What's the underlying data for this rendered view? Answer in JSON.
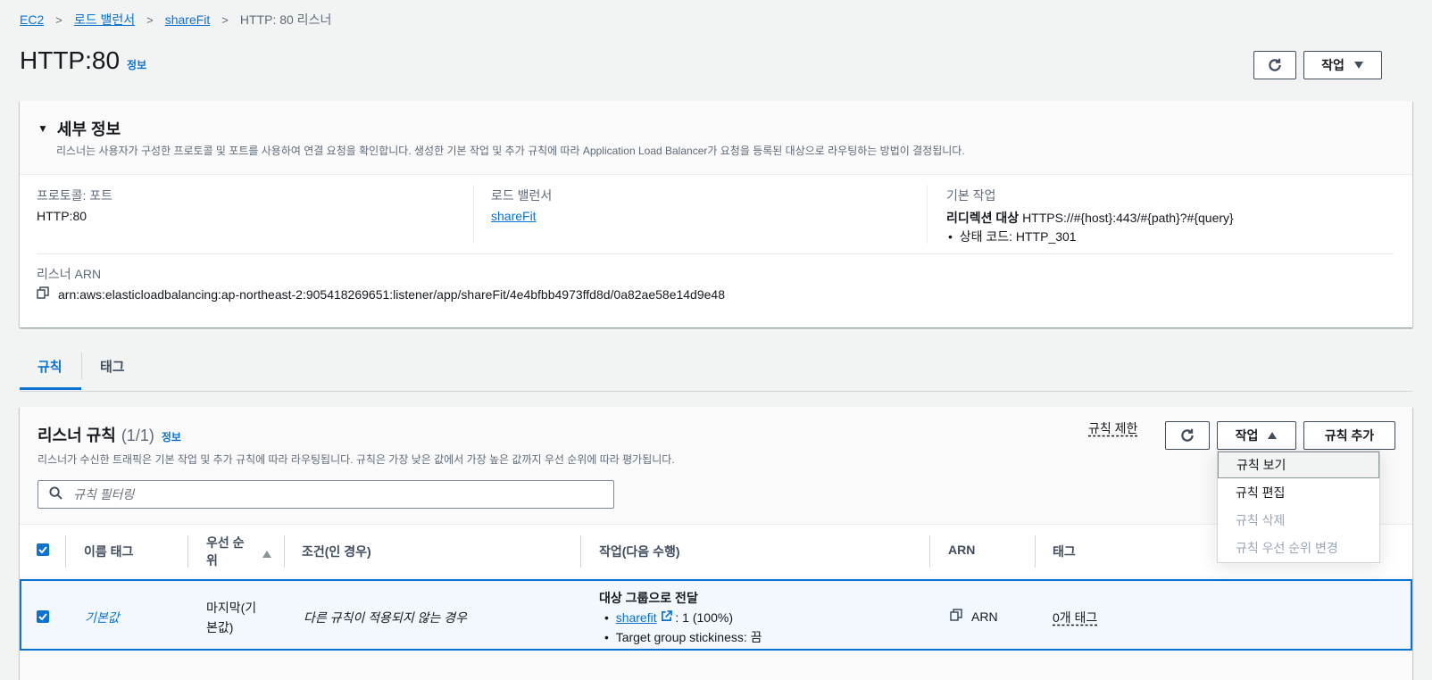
{
  "breadcrumb": {
    "items": [
      "EC2",
      "로드 밸런서",
      "shareFit"
    ],
    "current": "HTTP: 80 리스너"
  },
  "page": {
    "title": "HTTP:80",
    "info": "정보",
    "actions_label": "작업"
  },
  "details": {
    "title": "세부 정보",
    "description": "리스너는 사용자가 구성한 프로토콜 및 포트를 사용하여 연결 요청을 확인합니다. 생성한 기본 작업 및 추가 규칙에 따라 Application Load Balancer가 요청을 등록된 대상으로 라우팅하는 방법이 결정됩니다.",
    "protocol_port_label": "프로토콜: 포트",
    "protocol_port_value": "HTTP:80",
    "load_balancer_label": "로드 밸런서",
    "load_balancer_value": "shareFit",
    "default_action_label": "기본 작업",
    "redirect_label": "리디렉션 대상",
    "redirect_value": "HTTPS://#{host}:443/#{path}?#{query}",
    "status_code_label": "상태 코드:",
    "status_code_value": "HTTP_301",
    "arn_label": "리스너 ARN",
    "arn_value": "arn:aws:elasticloadbalancing:ap-northeast-2:905418269651:listener/app/shareFit/4e4bfbb4973ffd8d/0a82ae58e14d9e48"
  },
  "tabs": [
    "규칙",
    "태그"
  ],
  "rules": {
    "title": "리스너 규칙",
    "count": "(1/1)",
    "info": "정보",
    "description": "리스너가 수신한 트래픽은 기본 작업 및 추가 규칙에 따라 라우팅됩니다. 규칙은 가장 낮은 값에서 가장 높은 값까지 우선 순위에 따라 평가됩니다.",
    "limits_link": "규칙 제한",
    "actions_label": "작업",
    "add_rule_label": "규칙 추가",
    "filter_placeholder": "규칙 필터링",
    "columns": {
      "name_tag": "이름 태그",
      "priority_1": "우선 순",
      "priority_2": "위",
      "conditions": "조건(인 경우)",
      "actions": "작업(다음 수행)",
      "arn": "ARN",
      "tags": "태그"
    },
    "row": {
      "name": "기본값",
      "priority_1": "마지막(기",
      "priority_2": "본값)",
      "condition": "다른 규칙이 적용되지 않는 경우",
      "action_title": "대상 그룹으로 전달",
      "target_link": "sharefit",
      "target_weight": ": 1 (100%)",
      "stickiness": "Target group stickiness: 끔",
      "arn": "ARN",
      "tags": "0개 태그"
    },
    "dropdown": [
      "규칙 보기",
      "규칙 편집",
      "규칙 삭제",
      "규칙 우선 순위 변경"
    ]
  }
}
